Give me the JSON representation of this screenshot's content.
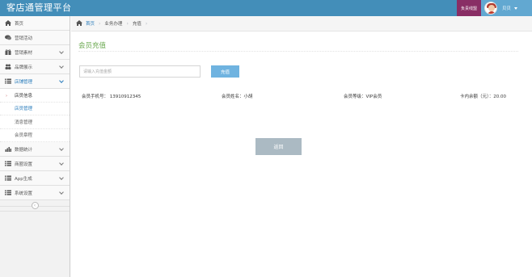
{
  "app": {
    "title": "客店通管理平台"
  },
  "header": {
    "help_label": "负责线盟",
    "user_name": "贝贝"
  },
  "sidebar": {
    "items": [
      {
        "label": "首页",
        "icon": "home-icon"
      },
      {
        "label": "营销活动",
        "icon": "chat-icon"
      },
      {
        "label": "营销素材",
        "icon": "gift-icon"
      },
      {
        "label": "品牌展示",
        "icon": "users-icon"
      },
      {
        "label": "店铺管理",
        "icon": "list-icon"
      },
      {
        "label": "数据统计",
        "icon": "bar-chart-icon"
      },
      {
        "label": "商圈设置",
        "icon": "list-icon"
      },
      {
        "label": "App生成",
        "icon": "list-icon"
      },
      {
        "label": "系统设置",
        "icon": "list-icon"
      }
    ],
    "sub_items": [
      "店员信息",
      "店员管理",
      "消息管理",
      "会员章程"
    ]
  },
  "breadcrumb": {
    "items": [
      "首页",
      "业务办理",
      "充值"
    ]
  },
  "main": {
    "title": "会员充值",
    "amount_placeholder": "请输入充值金额",
    "recharge_label": "充值",
    "member_phone": "会员手机号：  13910912345",
    "member_name": "会员姓名：小胡",
    "member_level": "会员等级：VIP会员",
    "card_balance": "卡内余额（元）：20.00",
    "back_label": "返回"
  },
  "colors": {
    "navbar": "#438eb9",
    "help": "#892e65",
    "user": "#62a8d1",
    "accent": "#2b7dbc",
    "title": "#6aa84f",
    "button": "#6fb3e0",
    "back": "#abbac3"
  }
}
